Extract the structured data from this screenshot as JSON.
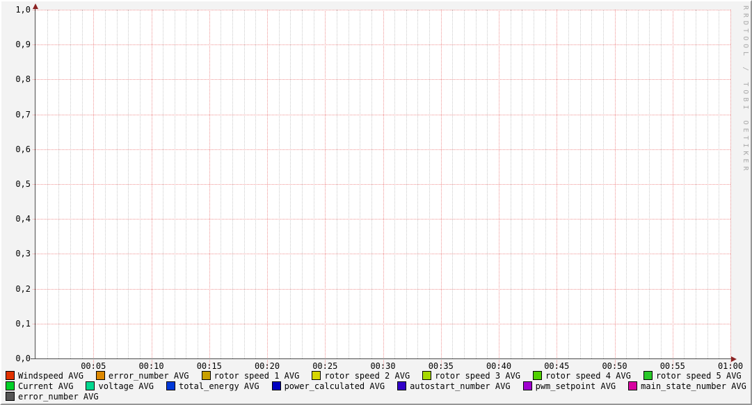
{
  "watermark": "RRDTOOL / TOBI OETIKER",
  "chart_data": {
    "type": "line",
    "title": "",
    "xlabel": "",
    "ylabel": "",
    "x_axis": {
      "range_minutes": 60,
      "minor_tick_minutes": 1,
      "major_tick_minutes": 5,
      "tick_labels": [
        "00:05",
        "00:10",
        "00:15",
        "00:20",
        "00:25",
        "00:30",
        "00:35",
        "00:40",
        "00:45",
        "00:50",
        "00:55",
        "01:00"
      ]
    },
    "y_axis": {
      "min": 0.0,
      "max": 1.0,
      "major_step": 0.1,
      "decimal_separator": ",",
      "tick_labels": [
        "1,0",
        "0,9",
        "0,8",
        "0,7",
        "0,6",
        "0,5",
        "0,4",
        "0,3",
        "0,2",
        "0,1",
        "0,0"
      ]
    },
    "grid": {
      "major_color": "#f09494",
      "minor_color": "#cbcbcb",
      "canvas_color": "#ffffff",
      "background_color": "#f3f3f3",
      "axis_color": "#4d4d4d",
      "arrow_color": "#8b2323",
      "watermark_color": "#a9a9a9"
    },
    "legend_position": "bottom",
    "series": [
      {
        "name": "Windspeed",
        "legend": "Windspeed AVG",
        "color": "#e13200",
        "row": 0,
        "values": []
      },
      {
        "name": "error_number",
        "legend": "error_number AVG",
        "color": "#dd8800",
        "row": 0,
        "values": []
      },
      {
        "name": "rotor speed 1",
        "legend": "rotor speed 1 AVG",
        "color": "#c8a000",
        "row": 0,
        "values": []
      },
      {
        "name": "rotor speed 2",
        "legend": "rotor speed 2 AVG",
        "color": "#d6d600",
        "row": 0,
        "values": []
      },
      {
        "name": "rotor speed 3",
        "legend": "rotor speed 3 AVG",
        "color": "#a6d800",
        "row": 0,
        "values": []
      },
      {
        "name": "rotor speed 4",
        "legend": "rotor speed 4 AVG",
        "color": "#50d000",
        "row": 0,
        "values": []
      },
      {
        "name": "rotor speed 5",
        "legend": "rotor speed 5 AVG",
        "color": "#28c828",
        "row": 0,
        "values": []
      },
      {
        "name": "Current",
        "legend": "Current AVG",
        "color": "#00d028",
        "row": 1,
        "values": []
      },
      {
        "name": "voltage",
        "legend": "voltage AVG",
        "color": "#00d890",
        "row": 1,
        "values": []
      },
      {
        "name": "total_energy",
        "legend": "total_energy AVG",
        "color": "#0038d8",
        "row": 1,
        "values": []
      },
      {
        "name": "power_calculated",
        "legend": "power_calculated AVG",
        "color": "#0000c0",
        "row": 1,
        "values": []
      },
      {
        "name": "autostart_number",
        "legend": "autostart_number AVG",
        "color": "#3000c8",
        "row": 1,
        "values": []
      },
      {
        "name": "pwm_setpoint",
        "legend": "pwm_setpoint AVG",
        "color": "#a000d0",
        "row": 1,
        "values": []
      },
      {
        "name": "main_state_number",
        "legend": "main_state_number AVG",
        "color": "#d800a0",
        "row": 1,
        "values": []
      },
      {
        "name": "error_number",
        "legend": "error_number AVG",
        "color": "#555555",
        "row": 2,
        "values": []
      }
    ]
  }
}
